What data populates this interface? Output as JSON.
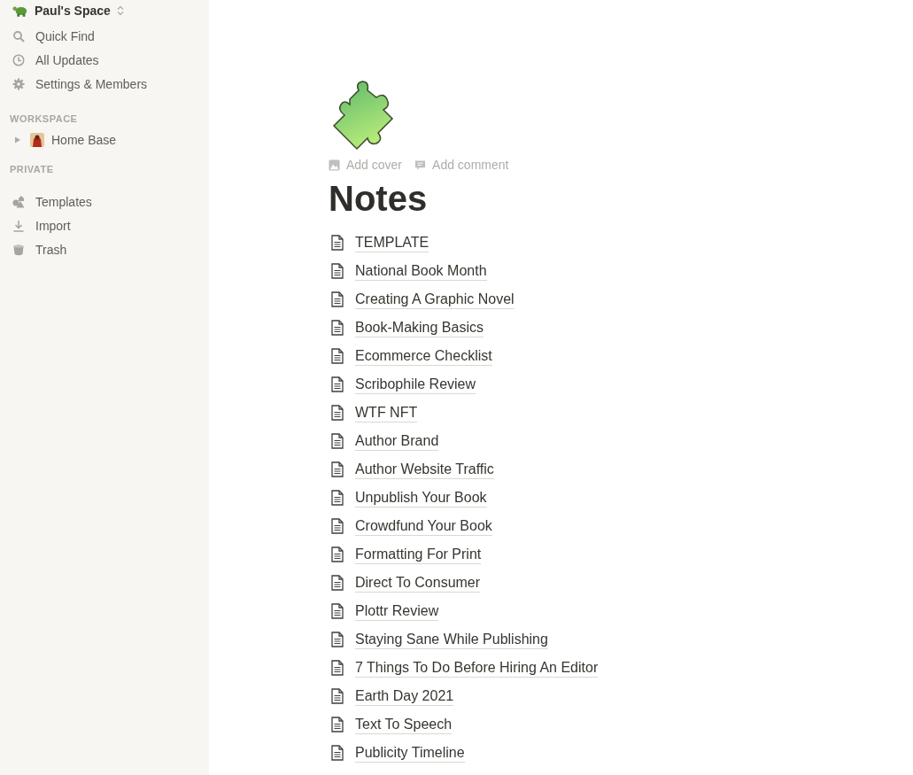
{
  "sidebar": {
    "workspace": {
      "name": "Paul's Space"
    },
    "menu": [
      {
        "label": "Quick Find",
        "kind": "search"
      },
      {
        "label": "All Updates",
        "kind": "clock"
      },
      {
        "label": "Settings & Members",
        "kind": "gear"
      }
    ],
    "sections": [
      {
        "title": "WORKSPACE",
        "items": [
          {
            "label": "Home Base",
            "expanded": false
          }
        ]
      },
      {
        "title": "PRIVATE"
      }
    ],
    "footer": [
      {
        "label": "Templates",
        "kind": "templates"
      },
      {
        "label": "Import",
        "kind": "import"
      },
      {
        "label": "Trash",
        "kind": "trash"
      }
    ]
  },
  "page": {
    "actions": [
      {
        "label": "Add cover",
        "kind": "cover"
      },
      {
        "label": "Add comment",
        "kind": "comment"
      }
    ],
    "title": "Notes",
    "pages": [
      "TEMPLATE",
      "National Book Month",
      "Creating A Graphic Novel",
      "Book-Making Basics",
      "Ecommerce Checklist",
      "Scribophile Review",
      "WTF NFT",
      "Author Brand",
      "Author Website Traffic",
      "Unpublish Your Book",
      "Crowdfund Your Book",
      "Formatting For Print",
      "Direct To Consumer",
      "Plottr Review",
      "Staying Sane While Publishing",
      "7 Things To Do Before Hiring An Editor",
      "Earth Day 2021",
      "Text To Speech",
      "Publicity Timeline"
    ]
  }
}
